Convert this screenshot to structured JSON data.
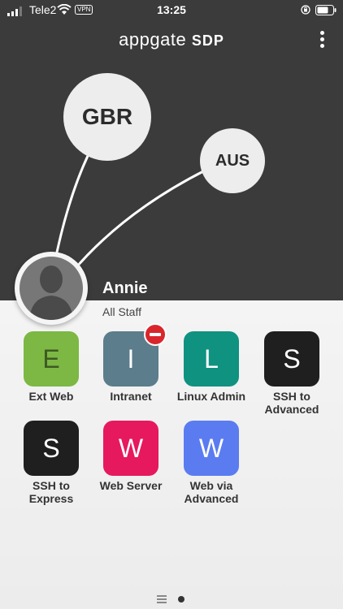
{
  "status_bar": {
    "carrier": "Tele2",
    "vpn": "VPN",
    "time": "13:25"
  },
  "header": {
    "logo_main": "appgate",
    "logo_sub": "SDP"
  },
  "sites": [
    {
      "label": "GBR"
    },
    {
      "label": "AUS"
    }
  ],
  "user": {
    "name": "Annie",
    "group": "All Staff"
  },
  "apps": [
    {
      "letter": "E",
      "label": "Ext Web",
      "color": "#7cb843",
      "text_color": "#3e5a23",
      "blocked": false
    },
    {
      "letter": "I",
      "label": "Intranet",
      "color": "#5c7d8b",
      "text_color": "#ffffff",
      "blocked": true
    },
    {
      "letter": "L",
      "label": "Linux Admin",
      "color": "#109281",
      "text_color": "#ffffff",
      "blocked": false
    },
    {
      "letter": "S",
      "label": "SSH to Advanced",
      "color": "#1f1f1f",
      "text_color": "#ffffff",
      "blocked": false
    },
    {
      "letter": "S",
      "label": "SSH to Express",
      "color": "#1f1f1f",
      "text_color": "#ffffff",
      "blocked": false
    },
    {
      "letter": "W",
      "label": "Web Server",
      "color": "#e6195e",
      "text_color": "#ffffff",
      "blocked": false
    },
    {
      "letter": "W",
      "label": "Web via Advanced",
      "color": "#5b7cf0",
      "text_color": "#ffffff",
      "blocked": false
    }
  ],
  "pager": {
    "pages": 2,
    "current": 1
  }
}
